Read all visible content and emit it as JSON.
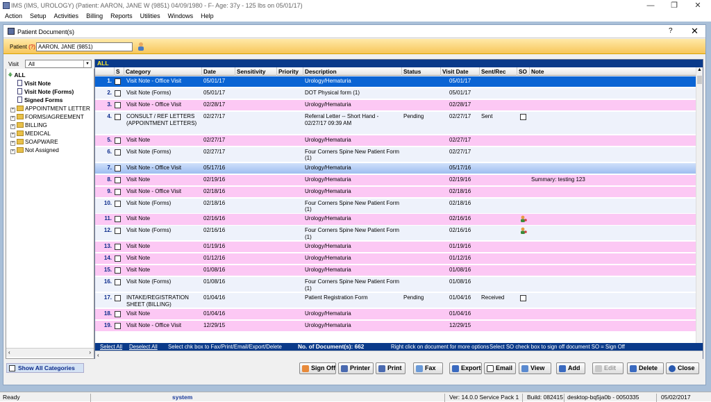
{
  "window": {
    "title": "IMS (IMS, UROLOGY)    (Patient: AARON, JANE W (9851) 04/09/1980 - F- Age: 37y  - 125 lbs on 05/01/17)",
    "minimize": "—",
    "restore": "❐",
    "close": "✕"
  },
  "menu": [
    "Action",
    "Setup",
    "Activities",
    "Billing",
    "Reports",
    "Utilities",
    "Windows",
    "Help"
  ],
  "dialog": {
    "title": "Patient Document(s)",
    "help": "?",
    "close": "✕"
  },
  "patient": {
    "label_prefix": "Patient ",
    "label_q": "(?)",
    "value": "AARON, JANE  (9851)"
  },
  "visit": {
    "label": "Visit",
    "selected": "All"
  },
  "tree": {
    "root": "ALL",
    "docs": [
      "Visit Note",
      "Visit Note (Forms)",
      "Signed Forms"
    ],
    "folders": [
      "APPOINTMENT LETTER",
      "FORMS/AGREEMENT",
      "BILLING",
      "MEDICAL",
      "SOAPWARE",
      "Not Assigned"
    ]
  },
  "grid": {
    "filter_label": "ALL",
    "headers": [
      "S",
      "Category",
      "Date",
      "Sensitivity",
      "Priority",
      "Description",
      "Status",
      "Visit Date",
      "Sent/Rec",
      "SO",
      "Note"
    ],
    "rows": [
      {
        "n": "1.",
        "category": "Visit Note - Office Visit",
        "date": "05/01/17",
        "description": "Urology/Hematuria",
        "status": "",
        "visit_date": "05/01/17",
        "sent": "",
        "so": "",
        "note": ""
      },
      {
        "n": "2.",
        "category": "Visit Note (Forms)",
        "date": "05/01/17",
        "description": "DOT Physical form (1)",
        "status": "",
        "visit_date": "05/01/17",
        "sent": "",
        "so": "",
        "note": ""
      },
      {
        "n": "3.",
        "category": "Visit Note - Office Visit",
        "date": "02/28/17",
        "description": "Urology/Hematuria",
        "status": "",
        "visit_date": "02/28/17",
        "sent": "",
        "so": "",
        "note": ""
      },
      {
        "n": "4.",
        "category": "CONSULT / REF LETTERS (APPOINTMENT LETTERS)",
        "date": "02/27/17",
        "description": "Referral Letter -- Short Hand - 02/27/17 09:39 AM",
        "status": "Pending",
        "visit_date": "02/27/17",
        "sent": "Sent",
        "so": "checkbox",
        "note": ""
      },
      {
        "n": "5.",
        "category": "Visit Note",
        "date": "02/27/17",
        "description": "Urology/Hematuria",
        "status": "",
        "visit_date": "02/27/17",
        "sent": "",
        "so": "",
        "note": ""
      },
      {
        "n": "6.",
        "category": "Visit Note (Forms)",
        "date": "02/27/17",
        "description": "Four Corners Spine New Patient Form (1)",
        "status": "",
        "visit_date": "02/27/17",
        "sent": "",
        "so": "",
        "note": ""
      },
      {
        "n": "7.",
        "category": "Visit Note - Office Visit",
        "date": "05/17/16",
        "description": "Urology/Hematuria",
        "status": "",
        "visit_date": "05/17/16",
        "sent": "",
        "so": "",
        "note": ""
      },
      {
        "n": "8.",
        "category": "Visit Note",
        "date": "02/19/16",
        "description": "Urology/Hematuria",
        "status": "",
        "visit_date": "02/19/16",
        "sent": "",
        "so": "",
        "note": "Summary: testing 123"
      },
      {
        "n": "9.",
        "category": "Visit Note - Office Visit",
        "date": "02/18/16",
        "description": "Urology/Hematuria",
        "status": "",
        "visit_date": "02/18/16",
        "sent": "",
        "so": "",
        "note": ""
      },
      {
        "n": "10.",
        "category": "Visit Note (Forms)",
        "date": "02/18/16",
        "description": "Four Corners Spine New Patient Form (1)",
        "status": "",
        "visit_date": "02/18/16",
        "sent": "",
        "so": "",
        "note": ""
      },
      {
        "n": "11.",
        "category": "Visit Note",
        "date": "02/16/16",
        "description": "Urology/Hematuria",
        "status": "",
        "visit_date": "02/16/16",
        "sent": "",
        "so": "icon",
        "note": ""
      },
      {
        "n": "12.",
        "category": "Visit Note (Forms)",
        "date": "02/16/16",
        "description": "Four Corners Spine New Patient Form (1)",
        "status": "",
        "visit_date": "02/16/16",
        "sent": "",
        "so": "icon",
        "note": ""
      },
      {
        "n": "13.",
        "category": "Visit Note",
        "date": "01/19/16",
        "description": "Urology/Hematuria",
        "status": "",
        "visit_date": "01/19/16",
        "sent": "",
        "so": "",
        "note": ""
      },
      {
        "n": "14.",
        "category": "Visit Note",
        "date": "01/12/16",
        "description": "Urology/Hematuria",
        "status": "",
        "visit_date": "01/12/16",
        "sent": "",
        "so": "",
        "note": ""
      },
      {
        "n": "15.",
        "category": "Visit Note",
        "date": "01/08/16",
        "description": "Urology/Hematuria",
        "status": "",
        "visit_date": "01/08/16",
        "sent": "",
        "so": "",
        "note": ""
      },
      {
        "n": "16.",
        "category": "Visit Note (Forms)",
        "date": "01/08/16",
        "description": "Four Corners Spine New Patient Form (1)",
        "status": "",
        "visit_date": "01/08/16",
        "sent": "",
        "so": "",
        "note": ""
      },
      {
        "n": "17.",
        "category": "INTAKE/REGISTRATION SHEET (BILLING)",
        "date": "01/04/16",
        "description": "Patient Registration Form",
        "status": "Pending",
        "visit_date": "01/04/16",
        "sent": "Received",
        "so": "checkbox",
        "note": ""
      },
      {
        "n": "18.",
        "category": "Visit Note",
        "date": "01/04/16",
        "description": "Urology/Hematuria",
        "status": "",
        "visit_date": "01/04/16",
        "sent": "",
        "so": "",
        "note": ""
      },
      {
        "n": "19.",
        "category": "Visit Note - Office Visit",
        "date": "12/29/15",
        "description": "Urology/Hematuria",
        "status": "",
        "visit_date": "12/29/15",
        "sent": "",
        "so": "",
        "note": ""
      }
    ],
    "footer": {
      "select_all": "Select All",
      "deselect_all": "Deselect All",
      "hint": "Select chk box to Fax/Print/Email/Export/Delete",
      "count": "No. of Document(s): 662",
      "right_click": "Right click on document for more options",
      "so_hint": "Select SO check box to sign off document   SO = Sign Off"
    }
  },
  "show_all": "Show All Categories",
  "buttons": [
    "Sign Off",
    "Printer",
    "Print",
    "Fax",
    "Export",
    "Email",
    "View",
    "Add",
    "Edit",
    "Delete",
    "Close"
  ],
  "status": {
    "ready": "Ready",
    "user": "system",
    "version": "Ver: 14.0.0 Service Pack 1",
    "build": "Build: 082415",
    "machine": "desktop-bq5ja0b - 0050335",
    "date": "05/02/2017"
  }
}
